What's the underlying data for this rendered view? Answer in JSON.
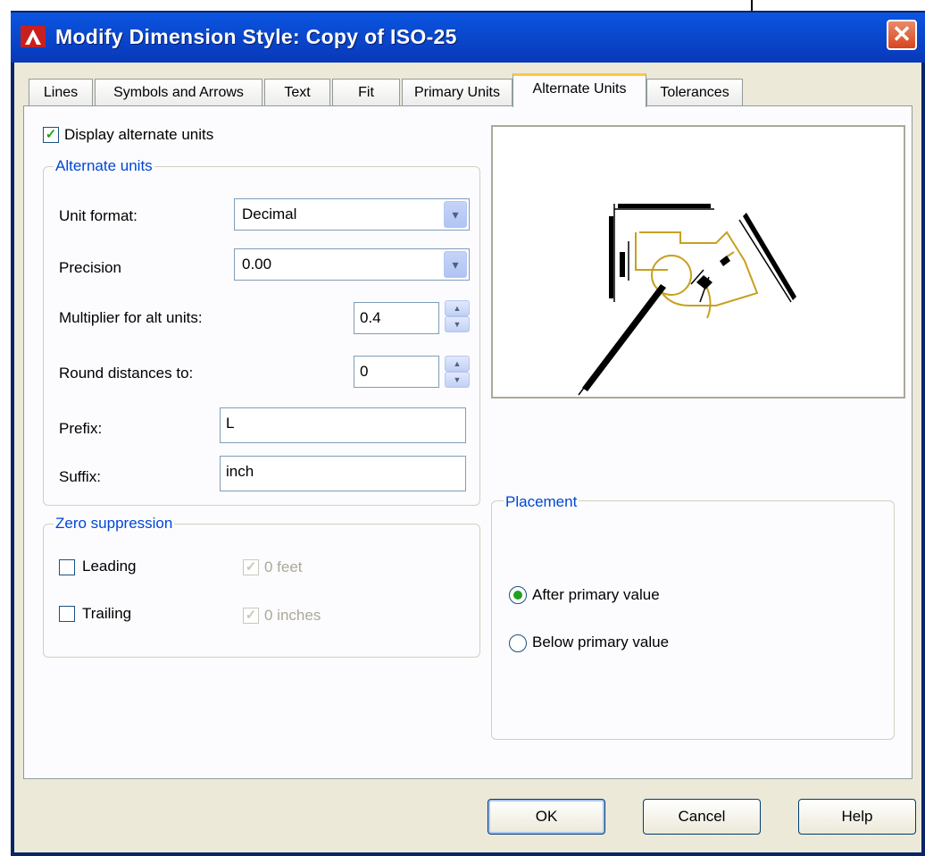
{
  "window": {
    "title": "Modify Dimension Style: Copy of ISO-25",
    "close_glyph": "✕"
  },
  "tabs": [
    {
      "label": "Lines"
    },
    {
      "label": "Symbols and Arrows"
    },
    {
      "label": "Text"
    },
    {
      "label": "Fit"
    },
    {
      "label": "Primary Units"
    },
    {
      "label": "Alternate Units"
    },
    {
      "label": "Tolerances"
    }
  ],
  "active_tab": "Alternate Units",
  "display_alternate_units": {
    "label": "Display alternate units",
    "checked": true
  },
  "alternate_units": {
    "group_label": "Alternate units",
    "unit_format_label": "Unit format:",
    "unit_format_value": "Decimal",
    "precision_label": "Precision",
    "precision_value": "0.00",
    "multiplier_label": "Multiplier for alt units:",
    "multiplier_value": "0.4",
    "round_label": "Round distances to:",
    "round_value": "0",
    "prefix_label": "Prefix:",
    "prefix_value": "L",
    "suffix_label": "Suffix:",
    "suffix_value": "inch"
  },
  "zero_suppression": {
    "group_label": "Zero suppression",
    "leading_label": "Leading",
    "trailing_label": "Trailing",
    "feet_label": "0 feet",
    "inches_label": "0 inches"
  },
  "placement": {
    "group_label": "Placement",
    "after_label": "After primary value",
    "below_label": "Below primary value",
    "selected": "After primary value"
  },
  "buttons": {
    "ok": "OK",
    "cancel": "Cancel",
    "help": "Help"
  },
  "colors": {
    "title_bar": "#0a4ad0",
    "group_label": "#0046d5",
    "check_mark": "#21a121",
    "preview_geometry": "#c8a020"
  },
  "icons": {
    "app": "autocad-logo-icon",
    "check": "✓",
    "dropdown": "▾",
    "spin_up": "▲",
    "spin_down": "▼"
  }
}
